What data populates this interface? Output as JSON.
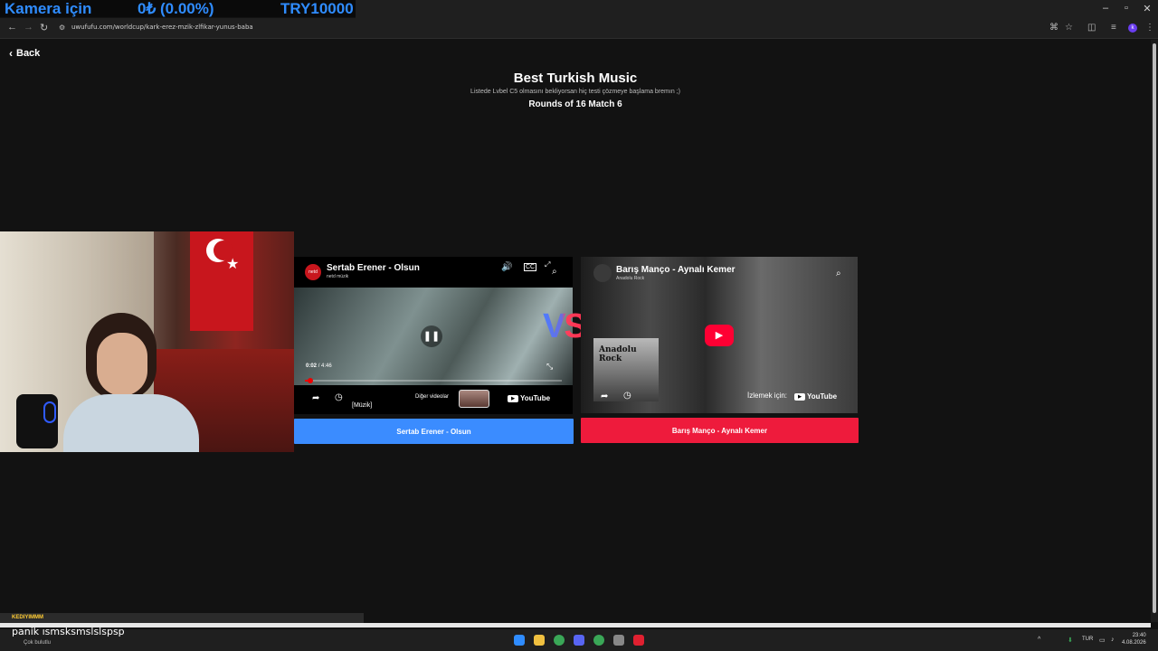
{
  "overlay": {
    "camera_label": "Kamera için",
    "balance": "0₺ (0.00%)",
    "target": "TRY10000"
  },
  "browser": {
    "url": "uwufufu.com/worldcup/kark-erez-mzik-zlfikar-yunus-baba",
    "profile_initial": "k"
  },
  "page": {
    "back_label": "Back",
    "title": "Best Turkish Music",
    "description": "Listede Lvbel C5 olmasını bekliyorsan hiç testi çözmeye başlama bremın ;)",
    "round": "Rounds of 16 Match 6",
    "vs": "VS"
  },
  "left_video": {
    "channel_logo_text": "netd",
    "title": "Sertab Erener - Olsun",
    "channel": "netd müzik",
    "time_current": "0:02",
    "time_total": "4:46",
    "progress_fraction": 0.02,
    "caption": "[Müzik]",
    "other_videos": "Diğer videolar",
    "youtube": "YouTube",
    "vote_label": "Sertab Erener - Olsun"
  },
  "right_video": {
    "title": "Barış Manço - Aynalı Kemer",
    "channel": "Anadolu Rock",
    "album_text": "Anadolu Rock",
    "watch_on": "İzlemek için:",
    "youtube": "YouTube",
    "vote_label": "Barış Manço - Aynalı Kemer"
  },
  "stream_chat": {
    "username": "KEDIYIMMM",
    "message": "panik ısmsksmslslspsp",
    "weather": "Çok bulutlu"
  },
  "taskbar": {
    "language": "TUR",
    "time": "23:40",
    "date": "4.08.2026"
  },
  "colors": {
    "vote_left": "#3b8cff",
    "vote_right": "#ee1b3c",
    "overlay_text": "#2f8cff"
  }
}
